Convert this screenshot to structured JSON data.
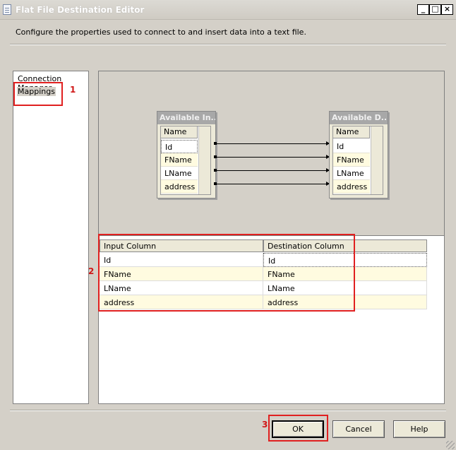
{
  "window": {
    "title": "Flat File Destination Editor",
    "buttons": {
      "minimize": "_",
      "maximize": "□",
      "close": "×"
    },
    "icon": "document-icon"
  },
  "description": "Configure the properties used to connect to and insert data into a text file.",
  "nav": {
    "items": [
      {
        "label": "Connection Manager"
      },
      {
        "label": "Mappings",
        "selected": true
      }
    ]
  },
  "diagram": {
    "left_table": {
      "title": "Available In...",
      "column_header": "Name",
      "rows": [
        "Id",
        "FName",
        "LName",
        "address"
      ]
    },
    "right_table": {
      "title": "Available D...",
      "column_header": "Name",
      "rows": [
        "Id",
        "FName",
        "LName",
        "address"
      ]
    }
  },
  "grid": {
    "headers": [
      "Input Column",
      "Destination Column"
    ],
    "rows": [
      {
        "input": "Id",
        "destination": "Id"
      },
      {
        "input": "FName",
        "destination": "FName"
      },
      {
        "input": "LName",
        "destination": "LName"
      },
      {
        "input": "address",
        "destination": "address"
      }
    ]
  },
  "buttons": {
    "ok": "OK",
    "cancel": "Cancel",
    "help": "Help"
  },
  "annotations": [
    "1",
    "2",
    "3"
  ],
  "colors": {
    "highlight": "#e02020",
    "annotation_text": "#d01818"
  }
}
